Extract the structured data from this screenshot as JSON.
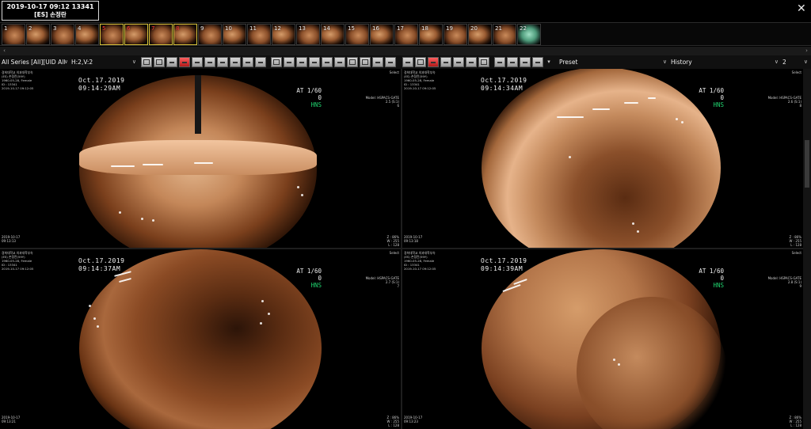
{
  "header": {
    "study_line1": "2019-10-17 09:12 13341",
    "study_line2": "[ES] 손정란",
    "close_symbol": "✕"
  },
  "thumbnails": [
    "1",
    "2",
    "3",
    "4",
    "5",
    "6",
    "7",
    "8",
    "9",
    "10",
    "11",
    "12",
    "13",
    "14",
    "15",
    "16",
    "17",
    "18",
    "19",
    "20",
    "21",
    "22"
  ],
  "toolbar": {
    "series_select": "All Series [All][UID All",
    "layout_select": "H:2,V:2",
    "preset_select": "Preset",
    "history_select": "History",
    "count_select": "2"
  },
  "viewports": [
    {
      "site": "경희대학교 의과대학부속",
      "patient": "(ES) 손정란(59Y)",
      "birth": "1960-05-28, Female",
      "id": "ID : 13341",
      "study_dt": "2019-10-17 09:12:05",
      "select": "Select",
      "model": "Model: HSPACS-GATE",
      "scale": "2.5 (S:1)",
      "frame": "6",
      "date": "Oct.17.2019",
      "time": "09:14:29AM",
      "at": "AT  1/60",
      "zero": "0",
      "hns": "HNS",
      "bottom_date": "2019-10-17",
      "bottom_time": "09:13:13",
      "zoom": "Z : 86%",
      "w": "W : 255",
      "l": "L : 128"
    },
    {
      "site": "경희대학교 의과대학부속",
      "patient": "(ES) 손정란(59Y)",
      "birth": "1960-05-28, Female",
      "id": "ID : 13341",
      "study_dt": "2019-10-17 09:12:05",
      "select": "Select",
      "model": "Model: HSPACS-GATE",
      "scale": "2.6 (S:1)",
      "frame": "8",
      "date": "Oct.17.2019",
      "time": "09:14:34AM",
      "at": "AT  1/60",
      "zero": "0",
      "hns": "HNS",
      "bottom_date": "2019-10-17",
      "bottom_time": "09:13:18",
      "zoom": "Z : 86%",
      "w": "W : 255",
      "l": "L : 128"
    },
    {
      "site": "경희대학교 의과대학부속",
      "patient": "(ES) 손정란(59Y)",
      "birth": "1960-05-28, Female",
      "id": "ID : 13341",
      "study_dt": "2019-10-17 09:12:05",
      "select": "Select",
      "model": "Model: HSPACS-GATE",
      "scale": "2.7 (S:1)",
      "frame": "7",
      "date": "Oct.17.2019",
      "time": "09:14:37AM",
      "at": "AT  1/60",
      "zero": "0",
      "hns": "HNS",
      "bottom_date": "2019-10-17",
      "bottom_time": "09:13:21",
      "zoom": "Z : 86%",
      "w": "W : 255",
      "l": "L : 128"
    },
    {
      "site": "경희대학교 의과대학부속",
      "patient": "(ES) 손정란(59Y)",
      "birth": "1960-05-28, Female",
      "id": "ID : 13341",
      "study_dt": "2019-10-17 09:12:05",
      "select": "Select",
      "model": "Model: HSPACS-GATE",
      "scale": "2.8 (S:1)",
      "frame": "9",
      "date": "Oct.17.2019",
      "time": "09:14:39AM",
      "at": "AT  1/60",
      "zero": "0",
      "hns": "HNS",
      "bottom_date": "2019-10-17",
      "bottom_time": "09:13:23",
      "zoom": "Z : 86%",
      "w": "W : 255",
      "l": "L : 128"
    }
  ]
}
